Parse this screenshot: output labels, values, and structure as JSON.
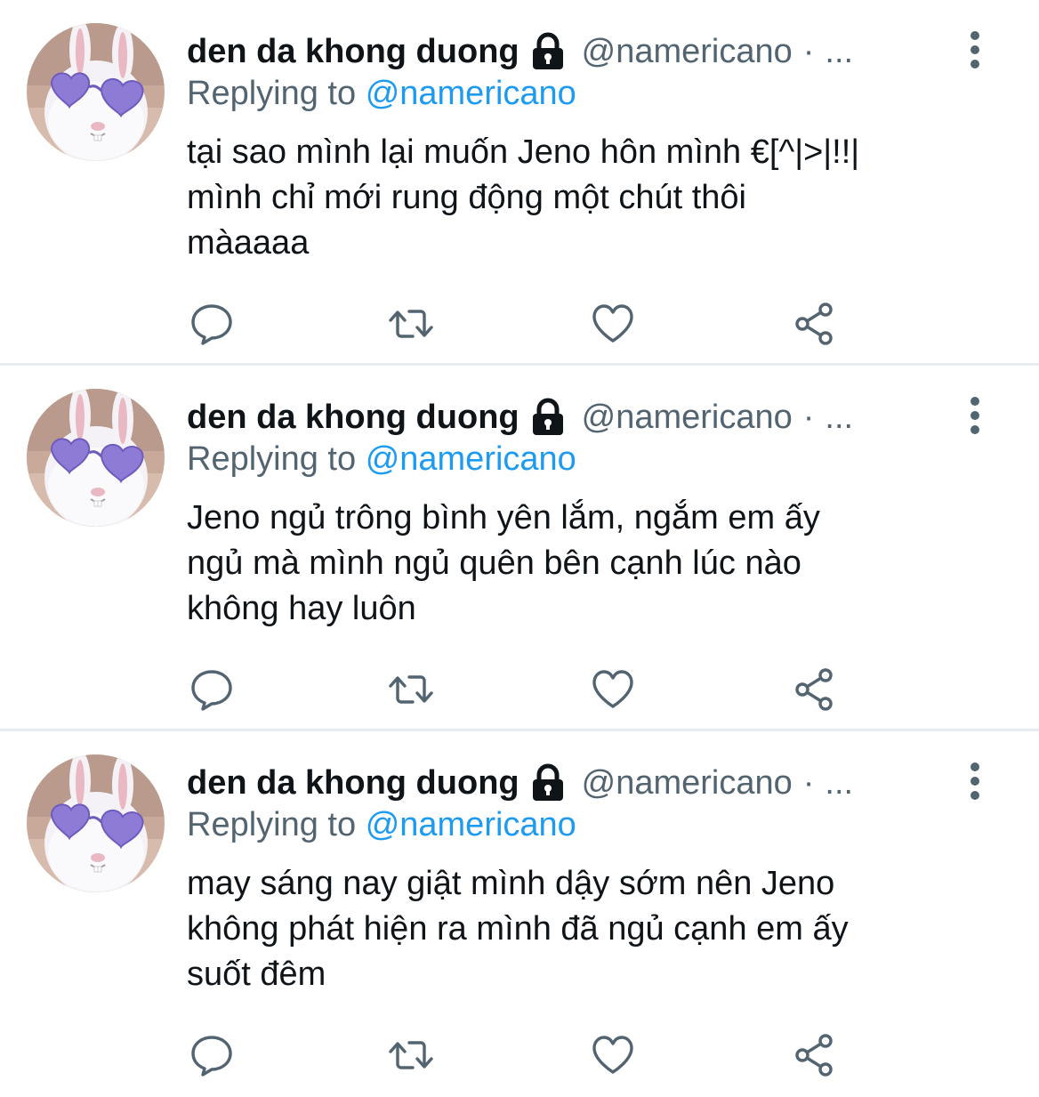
{
  "colors": {
    "text_primary": "#0f1419",
    "text_secondary": "#536471",
    "mention": "#1d9bf0",
    "divider": "#e6ecf0"
  },
  "tweets": [
    {
      "author_name": "den da khong duong",
      "handle": "@namericano",
      "separator": "·",
      "truncated_time": "...",
      "replying_prefix": "Replying to",
      "replying_to": "@namericano",
      "body_lines": [
        "tại sao mình lại muốn Jeno hôn mình €[^|>|!!|",
        "mình chỉ mới rung động một chút thôi",
        "màaaaa"
      ],
      "icons": [
        "lock-icon",
        "more-vertical-icon",
        "reply-icon",
        "retweet-icon",
        "like-icon",
        "share-icon"
      ]
    },
    {
      "author_name": "den da khong duong",
      "handle": "@namericano",
      "separator": "·",
      "truncated_time": "...",
      "replying_prefix": "Replying to",
      "replying_to": "@namericano",
      "body_lines": [
        "Jeno ngủ trông bình yên lắm, ngắm em ấy",
        "ngủ mà mình ngủ quên bên cạnh lúc nào",
        "không hay luôn"
      ],
      "icons": [
        "lock-icon",
        "more-vertical-icon",
        "reply-icon",
        "retweet-icon",
        "like-icon",
        "share-icon"
      ]
    },
    {
      "author_name": "den da khong duong",
      "handle": "@namericano",
      "separator": "·",
      "truncated_time": "...",
      "replying_prefix": "Replying to",
      "replying_to": "@namericano",
      "body_lines": [
        "may sáng nay giật mình dậy sớm nên Jeno",
        "không phát hiện ra mình đã ngủ cạnh em ấy",
        "suốt đêm"
      ],
      "icons": [
        "lock-icon",
        "more-vertical-icon",
        "reply-icon",
        "retweet-icon",
        "like-icon",
        "share-icon"
      ]
    }
  ]
}
